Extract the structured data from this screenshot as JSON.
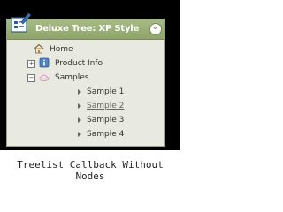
{
  "window": {
    "title": "Deluxe Tree: XP Style",
    "collapse_glyph": "«"
  },
  "tree": {
    "items": [
      {
        "label": "Home",
        "icon": "home-icon",
        "level": 0
      },
      {
        "label": "Product Info",
        "icon": "info-icon",
        "expander": "+",
        "level": 0
      },
      {
        "label": "Samples",
        "icon": "samples-icon",
        "expander": "−",
        "level": 0
      },
      {
        "label": "Sample 1",
        "level": 1
      },
      {
        "label": "Sample 2",
        "level": 1,
        "state": "hover"
      },
      {
        "label": "Sample 3",
        "level": 1
      },
      {
        "label": "Sample 4",
        "level": 1
      }
    ]
  },
  "caption": "Treelist Callback Without Nodes",
  "colors": {
    "header": "#9bb07a",
    "panel": "#e8e9e0",
    "frame": "#000000"
  }
}
